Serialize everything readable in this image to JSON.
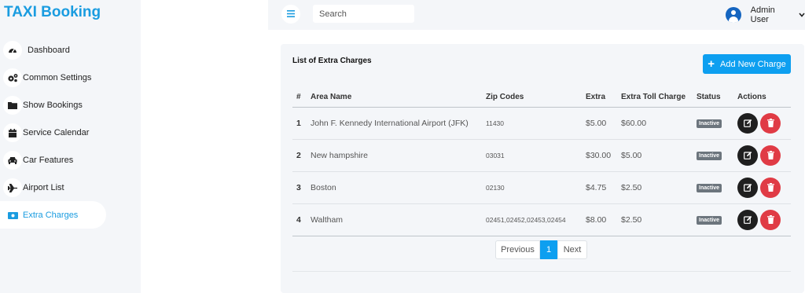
{
  "brand": "TAXI Booking",
  "sidebar": {
    "items": [
      {
        "label": "Dashboard",
        "icon": "dashboard-icon"
      },
      {
        "label": "Common Settings",
        "icon": "cogs-icon"
      },
      {
        "label": "Show Bookings",
        "icon": "folder-icon"
      },
      {
        "label": "Service Calendar",
        "icon": "calendar-icon"
      },
      {
        "label": "Car Features",
        "icon": "car-icon"
      },
      {
        "label": "Airport List",
        "icon": "plane-icon"
      },
      {
        "label": "Extra Charges",
        "icon": "money-icon",
        "active": true
      }
    ]
  },
  "topbar": {
    "search_placeholder": "Search",
    "user_name": "Admin User"
  },
  "card": {
    "title": "List of Extra Charges",
    "add_button": "Add New Charge"
  },
  "table": {
    "headers": [
      "#",
      "Area Name",
      "Zip Codes",
      "Extra",
      "Extra Toll Charge",
      "Status",
      "Actions"
    ],
    "rows": [
      {
        "num": "1",
        "area": "John F. Kennedy International Airport (JFK)",
        "zip": "11430",
        "extra": "$5.00",
        "toll": "$60.00",
        "status": "Inactive"
      },
      {
        "num": "2",
        "area": "New hampshire",
        "zip": "03031",
        "extra": "$30.00",
        "toll": "$5.00",
        "status": "Inactive"
      },
      {
        "num": "3",
        "area": "Boston",
        "zip": "02130",
        "extra": "$4.75",
        "toll": "$2.50",
        "status": "Inactive"
      },
      {
        "num": "4",
        "area": "Waltham",
        "zip": "02451,02452,02453,02454",
        "extra": "$8.00",
        "toll": "$2.50",
        "status": "Inactive"
      }
    ]
  },
  "pagination": {
    "previous": "Previous",
    "page": "1",
    "next": "Next"
  },
  "colors": {
    "accent": "#0d9ff0",
    "danger": "#e03b45",
    "badge": "#6c757d"
  }
}
